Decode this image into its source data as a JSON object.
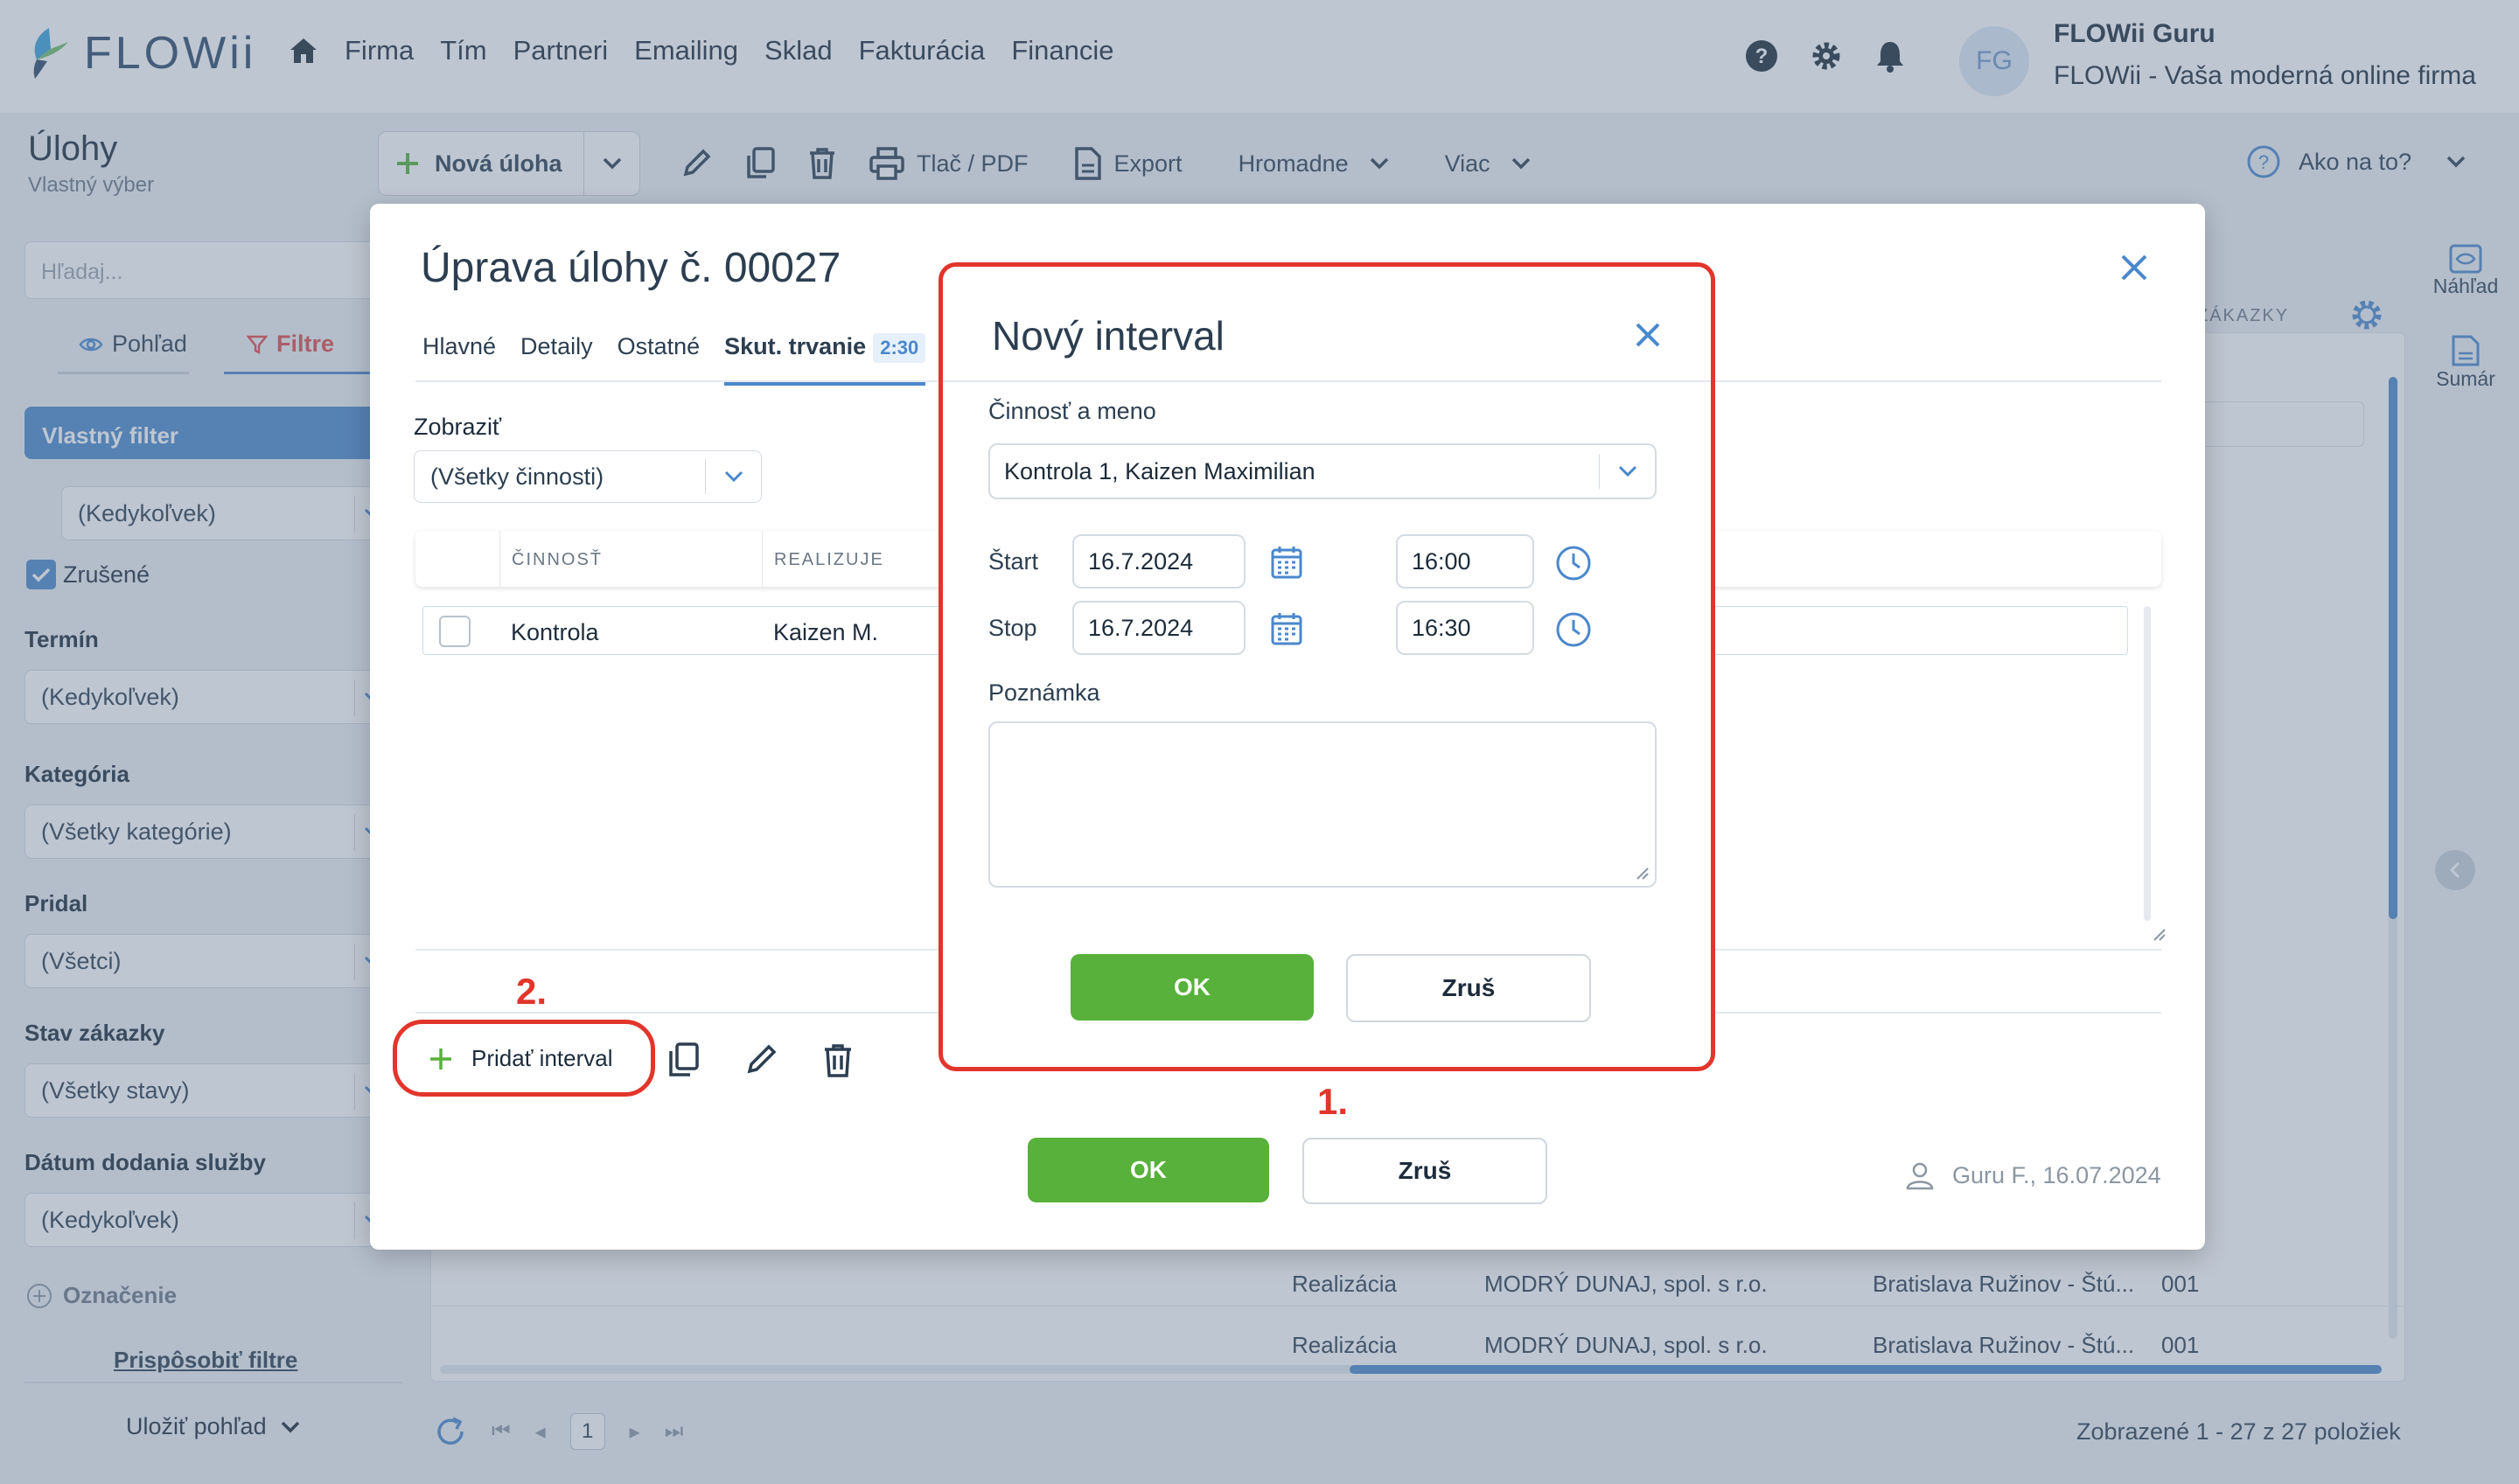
{
  "app": {
    "logo_text": "FLOWii"
  },
  "nav": {
    "items": [
      "Firma",
      "Tím",
      "Partneri",
      "Emailing",
      "Sklad",
      "Fakturácia",
      "Financie"
    ]
  },
  "user": {
    "initials": "FG",
    "name": "FLOWii Guru",
    "company": "FLOWii - Vaša moderná online firma"
  },
  "page": {
    "title": "Úlohy",
    "subtitle": "Vlastný výber"
  },
  "toolbar": {
    "new_task": "Nová úloha",
    "print": "Tlač / PDF",
    "export": "Export",
    "bulk": "Hromadne",
    "more": "Viac",
    "help": "Ako na to?"
  },
  "sidebar": {
    "search_placeholder": "Hľadaj...",
    "tab_view": "Pohľad",
    "tab_filters": "Filtre",
    "custom_filter": "Vlastný filter",
    "any_time": "(Kedykoľvek)",
    "cancelled": "Zrušené",
    "term_label": "Termín",
    "term_value": "(Kedykoľvek)",
    "category_label": "Kategória",
    "category_value": "(Všetky kategórie)",
    "added_label": "Pridal",
    "added_value": "(Všetci)",
    "order_state_label": "Stav zákazky",
    "order_state_value": "(Všetky stavy)",
    "delivery_label": "Dátum dodania služby",
    "delivery_value": "(Kedykoľvek)",
    "marking": "Označenie",
    "customize": "Prispôsobiť filtre",
    "save_view": "Uložiť pohľad"
  },
  "right_panel": {
    "preview": "Náhľad",
    "summary": "Sumár",
    "order_col": "ZÁKAZKY"
  },
  "bg_table": {
    "rows": [
      {
        "type": "Realizácia",
        "company": "MODRÝ DUNAJ, spol. s r.o.",
        "place": "Bratislava Ružinov - Štú...",
        "num": "001"
      },
      {
        "type": "Realizácia",
        "company": "MODRÝ DUNAJ, spol. s r.o.",
        "place": "Bratislava Ružinov - Štú...",
        "num": "001"
      }
    ],
    "page": "1",
    "summary": "Zobrazené 1 - 27 z 27 položiek"
  },
  "modal": {
    "title": "Úprava úlohy č. 00027",
    "tabs": [
      "Hlavné",
      "Detaily",
      "Ostatné",
      "Skut. trvanie"
    ],
    "badge": "2:30",
    "show_label": "Zobraziť",
    "show_value": "(Všetky činnosti)",
    "col_activity": "ČINNOSŤ",
    "col_realizes": "REALIZUJE",
    "row_activity": "Kontrola",
    "row_person": "Kaizen M.",
    "add_interval": "Pridať interval",
    "ok": "OK",
    "cancel": "Zruš",
    "footer_info": "Guru F., 16.07.2024"
  },
  "sub_modal": {
    "title": "Nový interval",
    "activity_label": "Činnosť a meno",
    "activity_value": "Kontrola 1, Kaizen Maximilian",
    "start_label": "Štart",
    "start_date": "16.7.2024",
    "start_time": "16:00",
    "stop_label": "Stop",
    "stop_date": "16.7.2024",
    "stop_time": "16:30",
    "note_label": "Poznámka",
    "ok": "OK",
    "cancel": "Zruš"
  },
  "annotations": {
    "step1": "1.",
    "step2": "2."
  },
  "colors": {
    "accent": "#4a88cc",
    "ok_green": "#57b13a",
    "annotation_red": "#e2352b",
    "filter_red": "#e04a4a"
  }
}
